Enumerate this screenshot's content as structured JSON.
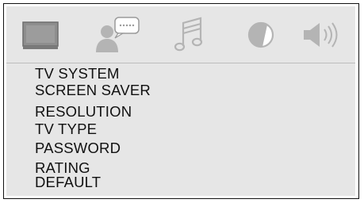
{
  "tabs": [
    {
      "icon": "tv-screen-icon",
      "selected": true
    },
    {
      "icon": "person-speech-icon",
      "selected": false
    },
    {
      "icon": "music-note-icon",
      "selected": false
    },
    {
      "icon": "contrast-icon",
      "selected": false
    },
    {
      "icon": "speaker-icon",
      "selected": false
    }
  ],
  "menu": {
    "items": [
      {
        "label": "TV SYSTEM"
      },
      {
        "label": "SCREEN SAVER"
      },
      {
        "label": "RESOLUTION"
      },
      {
        "label": "TV TYPE"
      },
      {
        "label": "PASSWORD"
      },
      {
        "label": "RATING"
      },
      {
        "label": "DEFAULT"
      }
    ]
  },
  "colors": {
    "panel": "#e6e6e6",
    "icon_selected": "#8e8e8e",
    "icon_inactive": "#b4b4b4",
    "text": "#111111"
  }
}
